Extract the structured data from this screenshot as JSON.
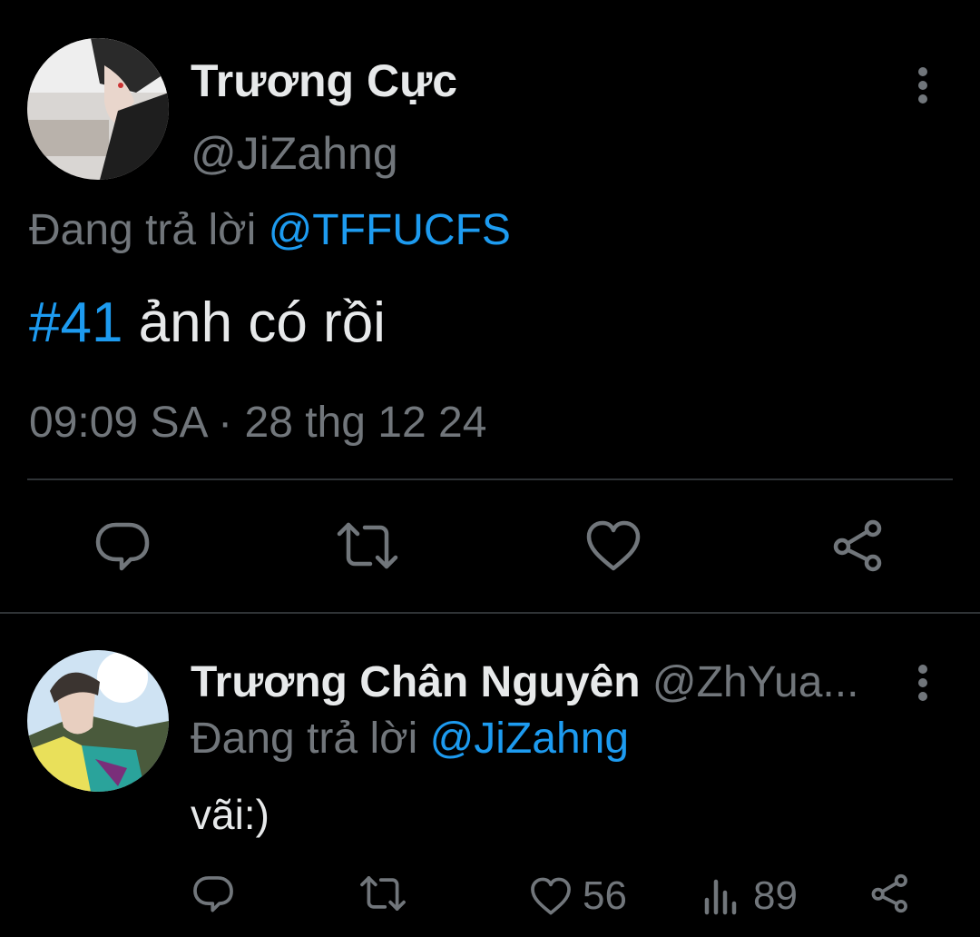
{
  "main_tweet": {
    "author_name": "Trương Cực",
    "author_handle": "@JiZahng",
    "replying_prefix": "Đang trả lời ",
    "replying_to": "@TFFUCFS",
    "hashtag": "#41",
    "text": " ảnh có rồi",
    "timestamp": "09:09 SA · 28 thg 12 24"
  },
  "reply_tweet": {
    "author_name": "Trương Chân Nguyên",
    "author_handle": "@ZhYua...",
    "replying_prefix": "Đang trả lời ",
    "replying_to": "@JiZahng",
    "text": "vãi:)",
    "like_count": "56",
    "view_count": "89"
  },
  "icons": {
    "more": "more-vertical-icon",
    "reply": "reply-icon",
    "retweet": "retweet-icon",
    "like": "heart-icon",
    "views": "views-icon",
    "share": "share-icon"
  },
  "colors": {
    "background": "#000000",
    "text": "#e7e9ea",
    "secondary": "#71767b",
    "link": "#1d9bf0",
    "divider": "#2f3336"
  }
}
